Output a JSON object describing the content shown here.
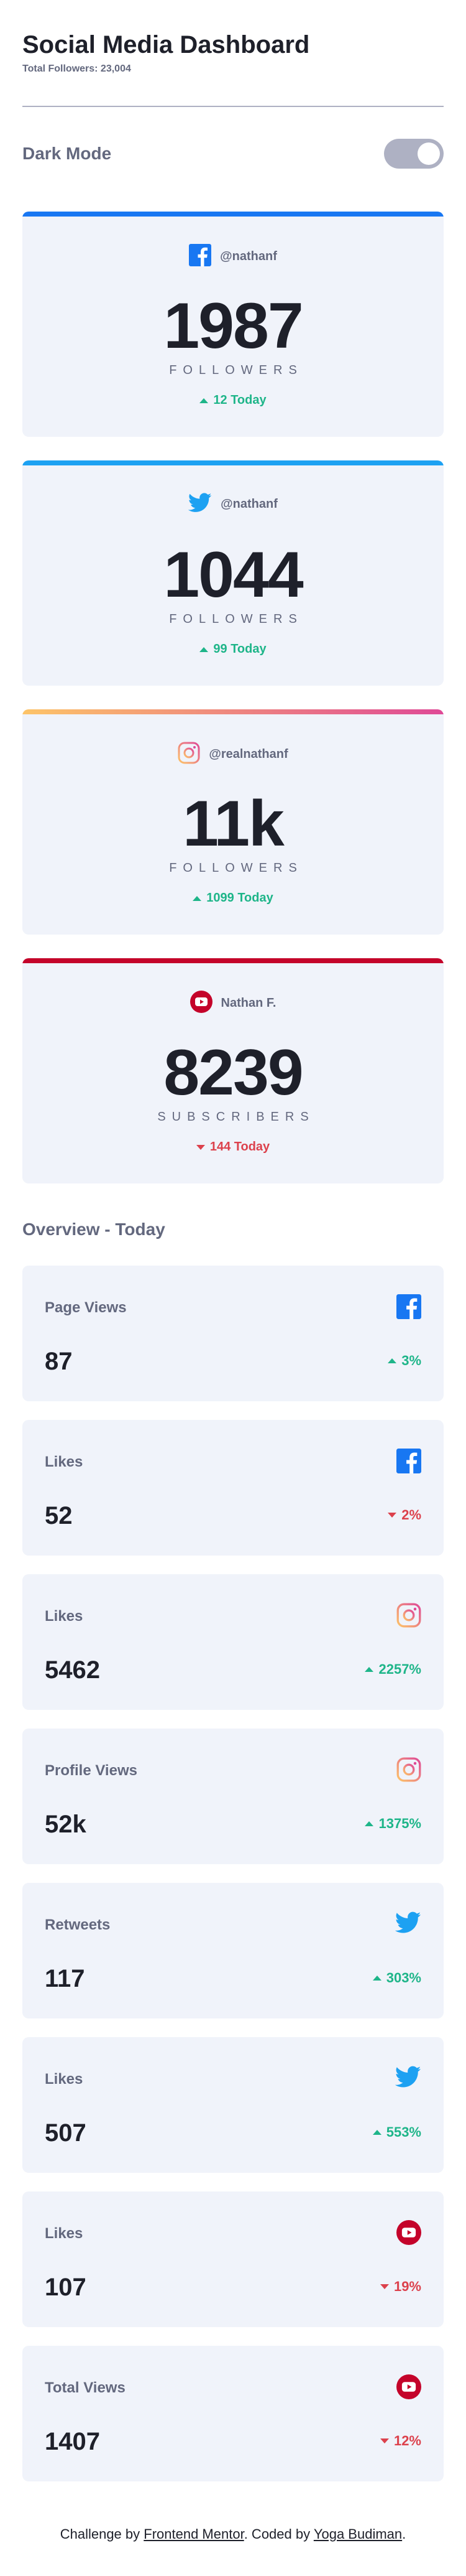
{
  "header": {
    "title": "Social Media Dashboard",
    "subtitle": "Total Followers: 23,004"
  },
  "dark_mode": {
    "label": "Dark Mode",
    "enabled": true
  },
  "colors": {
    "facebook": "#1877f2",
    "twitter": "#1da1f2",
    "instagram_gradient": [
      "#fdc468",
      "#df4996"
    ],
    "youtube": "#c4032a",
    "up": "#1eb589",
    "down": "#dc414c"
  },
  "followers": [
    {
      "network": "facebook",
      "icon": "facebook-icon",
      "handle": "@nathanf",
      "count": "1987",
      "unit": "Followers",
      "delta": "12 Today",
      "trend": "up"
    },
    {
      "network": "twitter",
      "icon": "twitter-icon",
      "handle": "@nathanf",
      "count": "1044",
      "unit": "Followers",
      "delta": "99 Today",
      "trend": "up"
    },
    {
      "network": "instagram",
      "icon": "instagram-icon",
      "handle": "@realnathanf",
      "count": "11k",
      "unit": "Followers",
      "delta": "1099 Today",
      "trend": "up"
    },
    {
      "network": "youtube",
      "icon": "youtube-icon",
      "handle": "Nathan F.",
      "count": "8239",
      "unit": "Subscribers",
      "delta": "144 Today",
      "trend": "down"
    }
  ],
  "overview": {
    "title": "Overview - Today",
    "items": [
      {
        "label": "Page Views",
        "network": "facebook",
        "icon": "facebook-icon",
        "value": "87",
        "delta": "3%",
        "trend": "up"
      },
      {
        "label": "Likes",
        "network": "facebook",
        "icon": "facebook-icon",
        "value": "52",
        "delta": "2%",
        "trend": "down"
      },
      {
        "label": "Likes",
        "network": "instagram",
        "icon": "instagram-icon",
        "value": "5462",
        "delta": "2257%",
        "trend": "up"
      },
      {
        "label": "Profile Views",
        "network": "instagram",
        "icon": "instagram-icon",
        "value": "52k",
        "delta": "1375%",
        "trend": "up"
      },
      {
        "label": "Retweets",
        "network": "twitter",
        "icon": "twitter-icon",
        "value": "117",
        "delta": "303%",
        "trend": "up"
      },
      {
        "label": "Likes",
        "network": "twitter",
        "icon": "twitter-icon",
        "value": "507",
        "delta": "553%",
        "trend": "up"
      },
      {
        "label": "Likes",
        "network": "youtube",
        "icon": "youtube-icon",
        "value": "107",
        "delta": "19%",
        "trend": "down"
      },
      {
        "label": "Total Views",
        "network": "youtube",
        "icon": "youtube-icon",
        "value": "1407",
        "delta": "12%",
        "trend": "down"
      }
    ]
  },
  "footer": {
    "prefix": "Challenge by ",
    "link1": "Frontend Mentor",
    "middle": ". Coded by ",
    "link2": "Yoga Budiman",
    "suffix": "."
  }
}
